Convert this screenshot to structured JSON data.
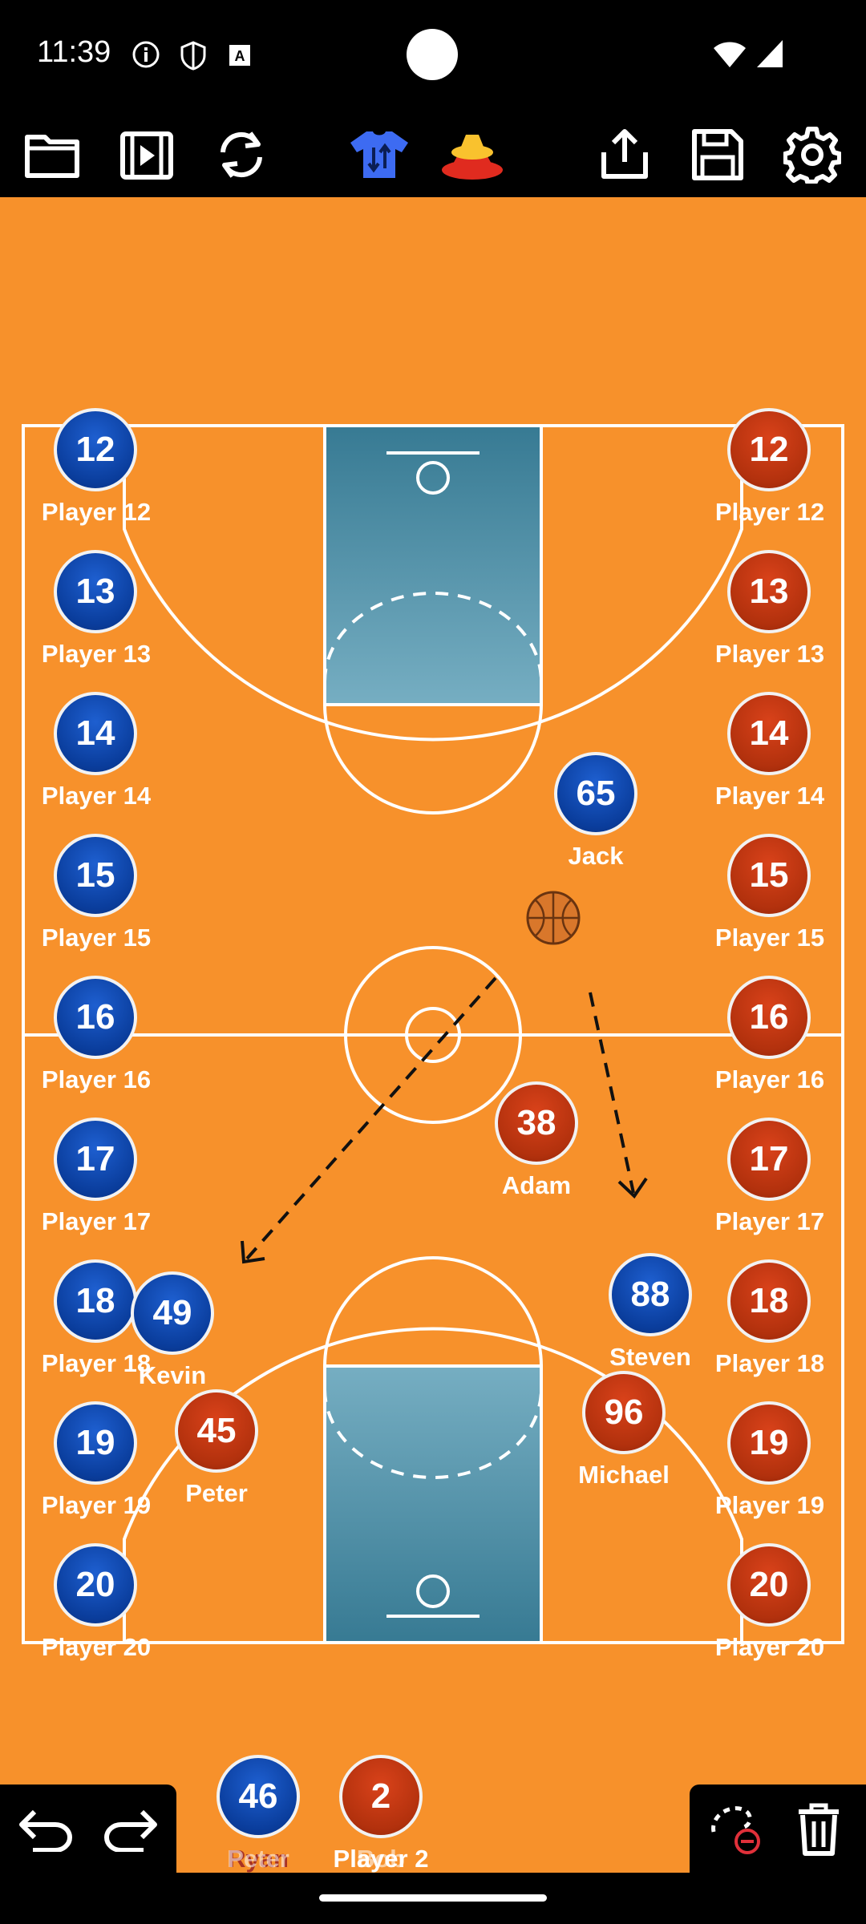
{
  "status": {
    "time": "11:39"
  },
  "toolbar": {
    "buttons": [
      "folder-icon",
      "video-icon",
      "refresh-icon",
      "jersey-swap-icon",
      "cones-icon",
      "share-icon",
      "save-icon",
      "settings-icon"
    ]
  },
  "left_bench": [
    {
      "num": "12",
      "name": "Player 12"
    },
    {
      "num": "13",
      "name": "Player 13"
    },
    {
      "num": "14",
      "name": "Player 14"
    },
    {
      "num": "15",
      "name": "Player 15"
    },
    {
      "num": "16",
      "name": "Player 16"
    },
    {
      "num": "17",
      "name": "Player 17"
    },
    {
      "num": "18",
      "name": "Player 18"
    },
    {
      "num": "19",
      "name": "Player 19"
    },
    {
      "num": "20",
      "name": "Player 20"
    }
  ],
  "right_bench": [
    {
      "num": "12",
      "name": "Player 12"
    },
    {
      "num": "13",
      "name": "Player 13"
    },
    {
      "num": "14",
      "name": "Player 14"
    },
    {
      "num": "15",
      "name": "Player 15"
    },
    {
      "num": "16",
      "name": "Player 16"
    },
    {
      "num": "17",
      "name": "Player 17"
    },
    {
      "num": "18",
      "name": "Player 18"
    },
    {
      "num": "19",
      "name": "Player 19"
    },
    {
      "num": "20",
      "name": "Player 20"
    }
  ],
  "court_players": {
    "jack": {
      "num": "65",
      "name": "Jack"
    },
    "adam": {
      "num": "38",
      "name": "Adam"
    },
    "kevin": {
      "num": "49",
      "name": "Kevin"
    },
    "peter": {
      "num": "45",
      "name": "Peter"
    },
    "steven": {
      "num": "88",
      "name": "Steven"
    },
    "michael": {
      "num": "96",
      "name": "Michael"
    }
  },
  "dock": {
    "blue": {
      "num": "46",
      "label_a": "Ryan",
      "label_b": "Peter"
    },
    "red": {
      "num": "2",
      "label_a": "Player 2",
      "label_b": "Bob"
    }
  },
  "colors": {
    "court": "#F7912B",
    "team_blue": "#0A3D9C",
    "team_red": "#B2310D",
    "paint": "#4F8FA8"
  }
}
